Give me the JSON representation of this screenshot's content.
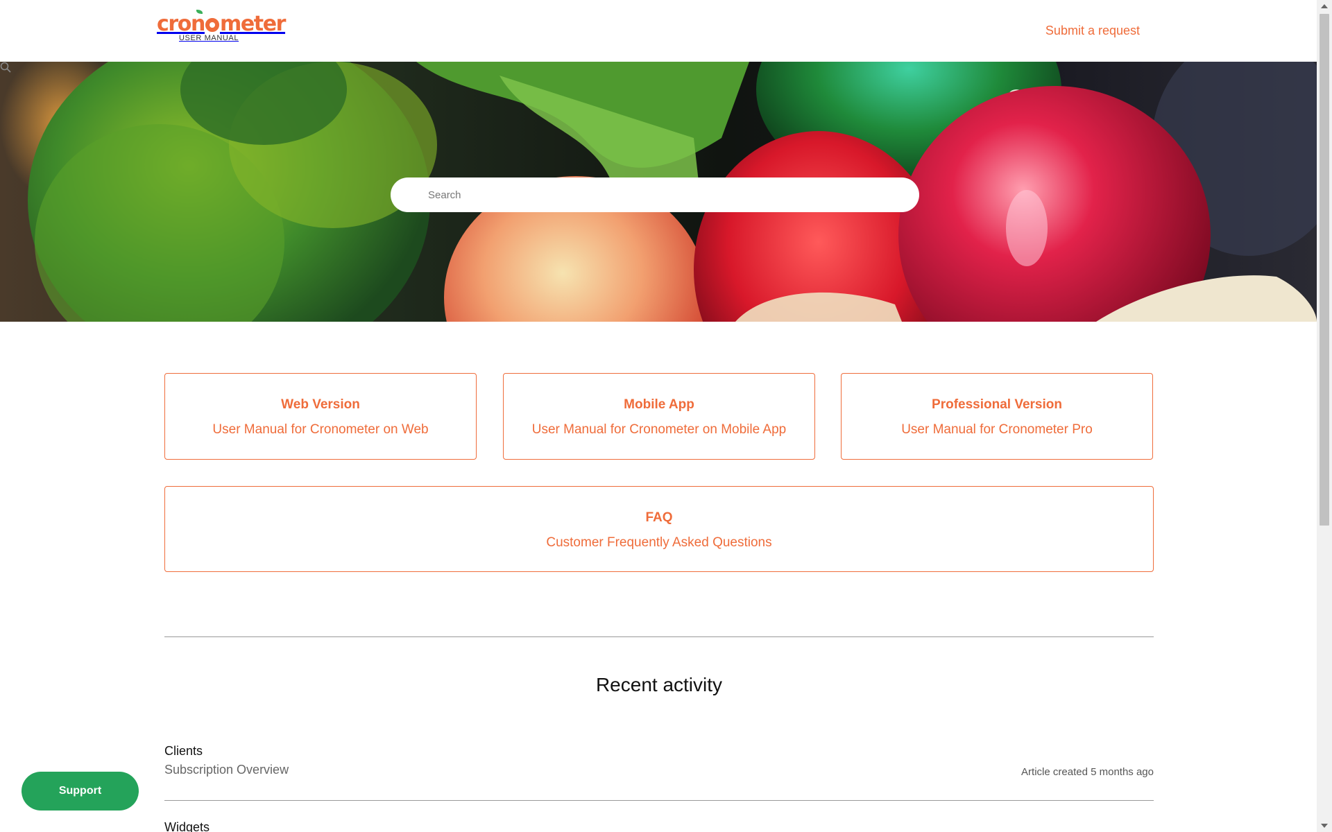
{
  "header": {
    "logo_text": "cronometer",
    "logo_subtitle": "USER MANUAL",
    "submit_request": "Submit a request"
  },
  "search": {
    "placeholder": "Search"
  },
  "cards": [
    {
      "title": "Web Version",
      "description": "User Manual for Cronometer on Web"
    },
    {
      "title": "Mobile App",
      "description": "User Manual for Cronometer on Mobile App"
    },
    {
      "title": "Professional Version",
      "description": "User Manual for Cronometer Pro"
    },
    {
      "title": "FAQ",
      "description": "Customer Frequently Asked Questions"
    }
  ],
  "recent_activity": {
    "title": "Recent activity",
    "items": [
      {
        "section": "Clients",
        "article": "Subscription Overview",
        "meta": "Article created",
        "time": "5 months ago"
      },
      {
        "section": "Widgets"
      }
    ]
  },
  "support_button": "Support",
  "colors": {
    "accent": "#ef6c3a",
    "support_green": "#24a35a"
  },
  "icons": {
    "search": "search-icon",
    "scroll_up": "scroll-up-arrow-icon",
    "scroll_down": "scroll-down-arrow-icon"
  }
}
